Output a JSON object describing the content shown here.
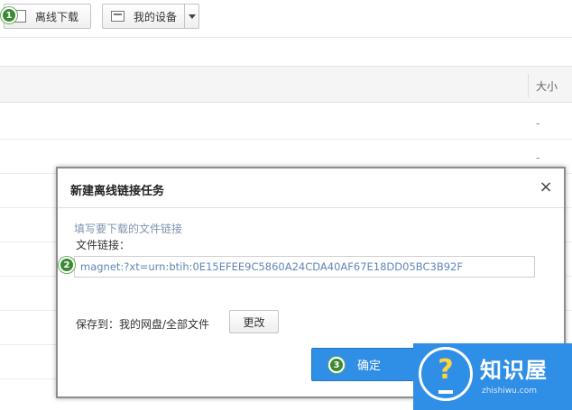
{
  "toolbar": {
    "offline_download_label": "离线下载",
    "my_devices_label": "我的设备"
  },
  "file_table": {
    "size_header": "大小",
    "rows": [
      {
        "size": "-"
      },
      {
        "size": "-"
      },
      {
        "size": ""
      },
      {
        "size": ""
      },
      {
        "size": ""
      },
      {
        "size": ""
      },
      {
        "size": ""
      },
      {
        "size": ""
      }
    ]
  },
  "markers": [
    "1",
    "2",
    "3"
  ],
  "dialog": {
    "title": "新建离线链接任务",
    "close_glyph": "×",
    "hint": "填写要下载的文件链接",
    "link_label": "文件链接：",
    "link_value": "magnet:?xt=urn:btih:0E15EFEE9C5860A24CDA40AF67E18DD05BC3B92F",
    "save_to_label": "保存到：我的网盘/全部文件",
    "change_button": "更改",
    "confirm_button": "确定",
    "cancel_button": ""
  },
  "watermark": {
    "brand": "知识屋",
    "url": "zhishiwu.com"
  },
  "colors": {
    "accent": "#2f8ee5",
    "marker_green": "#3d8a35",
    "hint_text": "#7f93b2",
    "link_text": "#5f87b8"
  },
  "icons": {
    "offline_download": "download-box-icon",
    "my_devices": "device-icon",
    "dropdown": "chevron-down-icon",
    "close": "close-icon",
    "watermark": "question-mark-icon"
  }
}
